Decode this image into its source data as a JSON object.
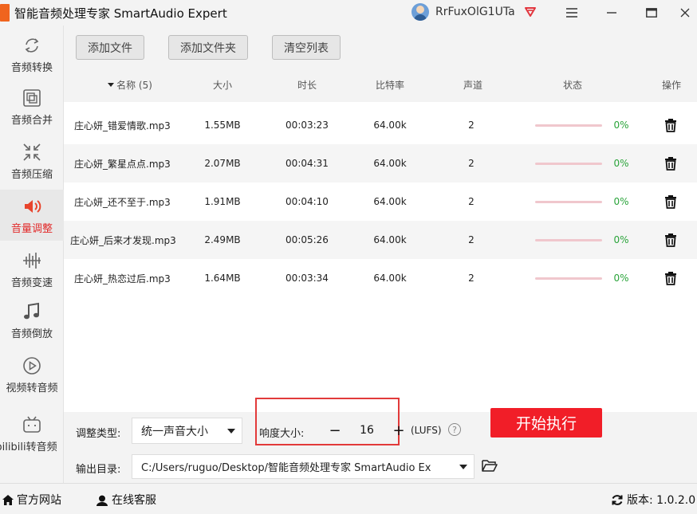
{
  "window": {
    "title": "智能音频处理专家 SmartAudio Expert",
    "username": "RrFuxOlG1UTa",
    "vip_icon": "diamond-icon",
    "controls": [
      "hamburger-menu-icon",
      "minimize-icon",
      "maximize-icon",
      "close-icon"
    ]
  },
  "sidebar": {
    "items": [
      {
        "label": "音频转换",
        "icon": "convert-icon",
        "active": false
      },
      {
        "label": "音频合并",
        "icon": "merge-icon",
        "active": false
      },
      {
        "label": "音频压缩",
        "icon": "compress-icon",
        "active": false
      },
      {
        "label": "音量调整",
        "icon": "speaker-icon",
        "active": true
      },
      {
        "label": "音频变速",
        "icon": "waveform-icon",
        "active": false
      },
      {
        "label": "音频倒放",
        "icon": "music-note-icon",
        "active": false
      },
      {
        "label": "视频转音频",
        "icon": "play-circle-icon",
        "active": false
      },
      {
        "label": "bilibili转音频",
        "icon": "bilibili-icon",
        "active": false
      }
    ]
  },
  "toolbar": {
    "add_file": "添加文件",
    "add_folder": "添加文件夹",
    "clear_list": "清空列表"
  },
  "table": {
    "headers": {
      "name": "名称 (5)",
      "size": "大小",
      "duration": "时长",
      "bitrate": "比特率",
      "channels": "声道",
      "status": "状态",
      "action": "操作"
    },
    "rows": [
      {
        "name": "庄心妍_错爱情歌.mp3",
        "size": "1.55MB",
        "duration": "00:03:23",
        "bitrate": "64.00k",
        "channels": "2",
        "progress": "0%",
        "progress_value": 0
      },
      {
        "name": "庄心妍_繁星点点.mp3",
        "size": "2.07MB",
        "duration": "00:04:31",
        "bitrate": "64.00k",
        "channels": "2",
        "progress": "0%",
        "progress_value": 0
      },
      {
        "name": "庄心妍_还不至于.mp3",
        "size": "1.91MB",
        "duration": "00:04:10",
        "bitrate": "64.00k",
        "channels": "2",
        "progress": "0%",
        "progress_value": 0
      },
      {
        "name": "庄心妍_后来才发现.mp3",
        "size": "2.49MB",
        "duration": "00:05:26",
        "bitrate": "64.00k",
        "channels": "2",
        "progress": "0%",
        "progress_value": 0
      },
      {
        "name": "庄心妍_热恋过后.mp3",
        "size": "1.64MB",
        "duration": "00:03:34",
        "bitrate": "64.00k",
        "channels": "2",
        "progress": "0%",
        "progress_value": 0
      }
    ]
  },
  "settings": {
    "adjust_type_label": "调整类型:",
    "adjust_type_value": "统一声音大小",
    "loudness_label": "响度大小:",
    "loudness_value": "16",
    "minus": "−",
    "plus": "+",
    "units": "(LUFS)",
    "help": "?",
    "output_label": "输出目录:",
    "output_path": "C:/Users/ruguo/Desktop/智能音频处理专家 SmartAudio Ex",
    "start_button": "开始执行"
  },
  "statusbar": {
    "website": "官方网站",
    "support": "在线客服",
    "version": "版本: 1.0.2.0"
  },
  "colors": {
    "accent": "#f11e28",
    "progress_track": "#f0c7cd",
    "percent_text": "#2aa43a",
    "highlight_box": "#e23a3a"
  }
}
